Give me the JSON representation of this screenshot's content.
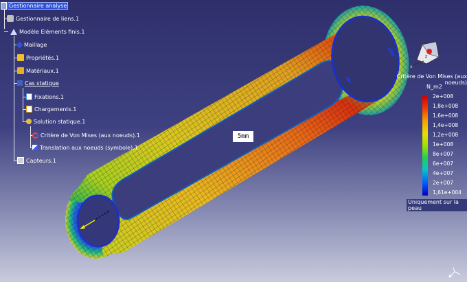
{
  "tree": {
    "items": [
      {
        "label": "Gestionnaire analyse",
        "icon": "analysis-manager-icon"
      },
      {
        "label": "Gestionnaire de liens.1",
        "icon": "links-manager-icon"
      },
      {
        "label": "Modèle Eléments finis.1",
        "icon": "fem-model-icon"
      },
      {
        "label": "Maillage",
        "icon": "mesh-icon"
      },
      {
        "label": "Propriétés.1",
        "icon": "properties-folder-icon"
      },
      {
        "label": "Matériaux.1",
        "icon": "materials-folder-icon"
      },
      {
        "label": "Cas statique",
        "icon": "static-case-icon"
      },
      {
        "label": "Fixations.1",
        "icon": "restraints-icon"
      },
      {
        "label": "Chargements.1",
        "icon": "loads-icon"
      },
      {
        "label": "Solution statique.1",
        "icon": "static-solution-icon"
      },
      {
        "label": "Critère de Von Mises (aux noeuds).1",
        "icon": "von-mises-image-icon"
      },
      {
        "label": "Translation aux noeuds (symbole).1",
        "icon": "translation-image-icon"
      },
      {
        "label": "Capteurs.1",
        "icon": "sensors-icon"
      }
    ]
  },
  "legend": {
    "title": "Critère de Von Mises (aux noeuds)",
    "unit": "N_m2",
    "ticks": [
      "2e+008",
      "1,8e+008",
      "1,6e+008",
      "1,4e+008",
      "1,2e+008",
      "1e+008",
      "8e+007",
      "6e+007",
      "4e+007",
      "2e+007",
      "1,61e+004"
    ],
    "footer": "Uniquement sur la peau"
  },
  "annotation": {
    "label": "5mm"
  },
  "colors": {
    "background_top": "#2e2f6b",
    "background_bottom": "#c9cbdd",
    "selected": "#2b4fd8"
  }
}
